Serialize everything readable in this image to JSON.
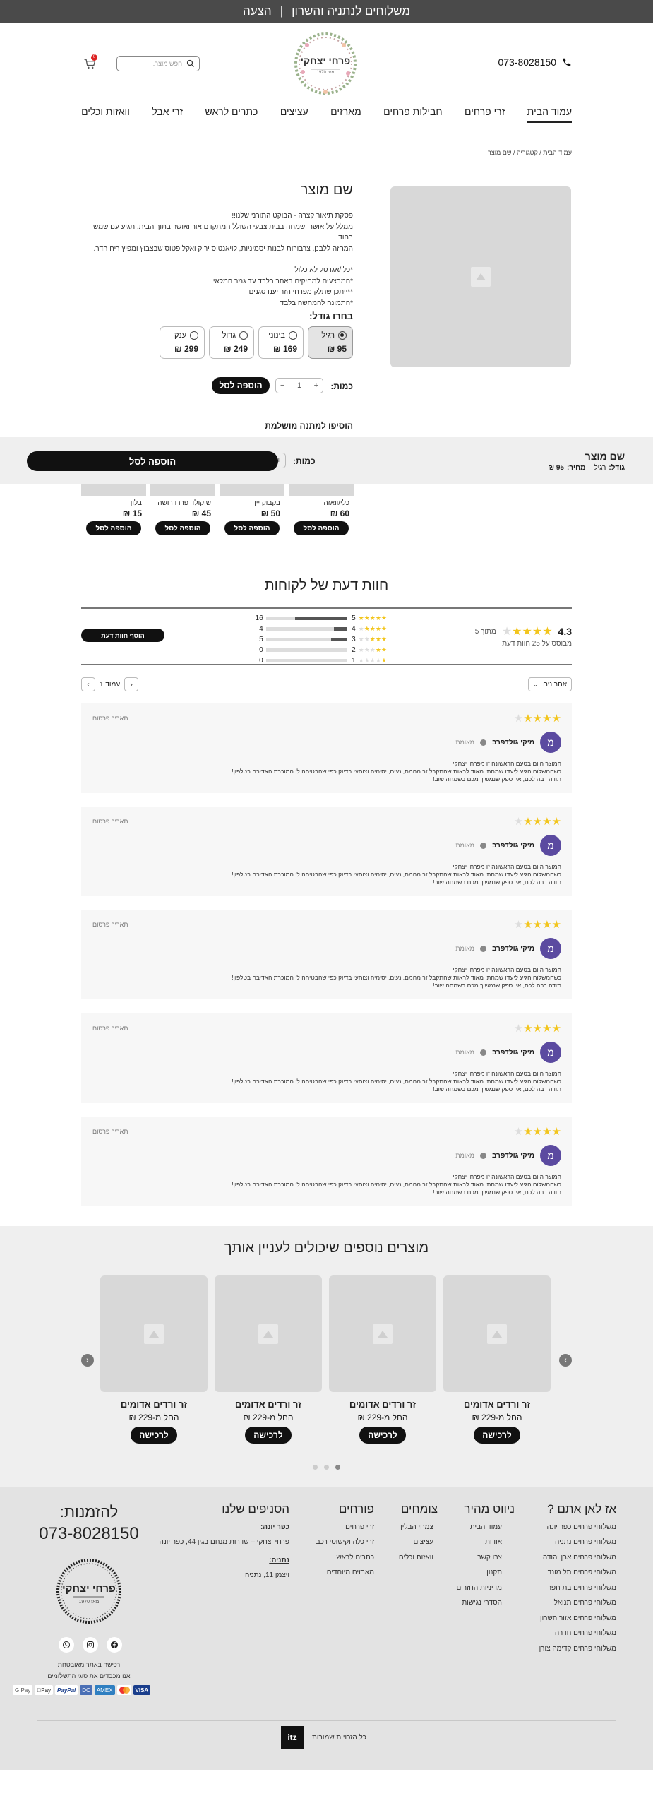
{
  "topbar": {
    "left": "משלוחים לנתניה והשרון",
    "sep": "|",
    "right": "הצעה"
  },
  "header": {
    "phone": "073-8028150",
    "search_placeholder": "חפש מוצר..",
    "cart_count": "0",
    "brand": "פרחי יצחקי",
    "brand_sub": "מאז 1970"
  },
  "nav": [
    "עמוד הבית",
    "זרי פרחים",
    "חבילות פרחים",
    "מארזים",
    "עציצים",
    "כתרים לראש",
    "זרי אבל",
    "וואזות וכלים"
  ],
  "breadcrumb": "עמוד הבית / קטגוריה / שם מוצר",
  "product": {
    "title": "שם מוצר",
    "desc": [
      "פסקת תיאור קצרה - הבוקט התורני שלנו!!",
      "ממלל על אושר ושמחה בבית צבעי השולל המתקדם אור ואושר בתוך הבית, תגיע עם שמש בחוד",
      "המחזה ללבנן, צרבורות לבנות יסמיניות, לויאנטוס ירוק ואקליפטוס שבצבוץ ומפיץ ריח הדר.",
      "",
      "*כלי/אגרטל לא כלול",
      "*המבצעים למחיקים באחר בלבד עד גמר המלאי",
      "**ייתכן שתלק מפרחי הזר יענו סגנים",
      "*התמונה להמחשה בלבד"
    ],
    "sizes_label": "בחרו גודל:",
    "sizes": [
      {
        "name": "רגיל",
        "price": "95 ₪"
      },
      {
        "name": "בינוני",
        "price": "169 ₪"
      },
      {
        "name": "גדול",
        "price": "249 ₪"
      },
      {
        "name": "ענק",
        "price": "299 ₪"
      }
    ],
    "qty_label": "כמות:",
    "qty": "1",
    "plus": "+",
    "minus": "−",
    "add_label": "הוספה לסל",
    "gift_label": "הוסיפו למתנה מושלמת"
  },
  "sticky": {
    "title": "שם מוצר",
    "size_label": "גודל:",
    "size_value": "רגיל",
    "price_label": "מחיר:",
    "price_value": "95 ₪",
    "qty_label": "כמות:",
    "qty": "1",
    "add_label": "הוספה לסל"
  },
  "gifts": [
    {
      "name": "כלי/וואזה",
      "price": "60 ₪"
    },
    {
      "name": "בקבוק יין",
      "price": "50 ₪"
    },
    {
      "name": "שוקולד פררו רושה",
      "price": "45 ₪"
    },
    {
      "name": "בלון",
      "price": "15 ₪"
    }
  ],
  "gift_add": "הוספה לסל",
  "reviews": {
    "title": "חוות דעת של לקוחות",
    "avg": "4.3",
    "out_of": "מתוך 5",
    "based": "מבוסס על 25 חוות דעת",
    "avg_stars": 4,
    "dist": [
      {
        "label": "5",
        "count": "16",
        "ratio": 0.64
      },
      {
        "label": "4",
        "count": "4",
        "ratio": 0.16
      },
      {
        "label": "3",
        "count": "5",
        "ratio": 0.2
      },
      {
        "label": "2",
        "count": "0",
        "ratio": 0
      },
      {
        "label": "1",
        "count": "0",
        "ratio": 0
      }
    ],
    "add_btn": "הוסף חוות דעת",
    "sort": "אחרונים",
    "pager": "עמוד 1",
    "items": [
      {
        "initial": "מ",
        "name": "מיקי גולדפרב",
        "verified": "מאומת",
        "date": "תאריך פרסום",
        "stars": 4,
        "lines": [
          "המוצר היום בטעם הראשונה זו מפרחי יצחקי",
          "כשהמשלוח הגיע ליעדו שמחתי מאוד לראות שהתקבל זר מהמם, נעים, יסימיה וצוחעי בדיוק כפי שהבטיחה לי המוכרת האדיבה בטלפון!",
          "תודה רבה לכם, אין ספק שנמשיך מכם בשמחה שוב!"
        ]
      },
      {
        "initial": "מ",
        "name": "מיקי גולדפרב",
        "verified": "מאומת",
        "date": "תאריך פרסום",
        "stars": 4,
        "lines": [
          "המוצר היום בטעם הראשונה זו מפרחי יצחקי",
          "כשהמשלוח הגיע ליעדו שמחתי מאוד לראות שהתקבל זר מהמם, נעים, יסימיה וצוחעי בדיוק כפי שהבטיחה לי המוכרת האדיבה בטלפון!",
          "תודה רבה לכם, אין ספק שנמשיך מכם בשמחה שוב!"
        ]
      },
      {
        "initial": "מ",
        "name": "מיקי גולדפרב",
        "verified": "מאומת",
        "date": "תאריך פרסום",
        "stars": 4,
        "lines": [
          "המוצר היום בטעם הראשונה זו מפרחי יצחקי",
          "כשהמשלוח הגיע ליעדו שמחתי מאוד לראות שהתקבל זר מהמם, נעים, יסימיה וצוחעי בדיוק כפי שהבטיחה לי המוכרת האדיבה בטלפון!",
          "תודה רבה לכם, אין ספק שנמשיך מכם בשמחה שוב!"
        ]
      },
      {
        "initial": "מ",
        "name": "מיקי גולדפרב",
        "verified": "מאומת",
        "date": "תאריך פרסום",
        "stars": 4,
        "lines": [
          "המוצר היום בטעם הראשונה זו מפרחי יצחקי",
          "כשהמשלוח הגיע ליעדו שמחתי מאוד לראות שהתקבל זר מהמם, נעים, יסימיה וצוחעי בדיוק כפי שהבטיחה לי המוכרת האדיבה בטלפון!",
          "תודה רבה לכם, אין ספק שנמשיך מכם בשמחה שוב!"
        ]
      },
      {
        "initial": "מ",
        "name": "מיקי גולדפרב",
        "verified": "מאומת",
        "date": "תאריך פרסום",
        "stars": 4,
        "lines": [
          "המוצר היום בטעם הראשונה זו מפרחי יצחקי",
          "כשהמשלוח הגיע ליעדו שמחתי מאוד לראות שהתקבל זר מהמם, נעים, יסימיה וצוחעי בדיוק כפי שהבטיחה לי המוכרת האדיבה בטלפון!",
          "תודה רבה לכם, אין ספק שנמשיך מכם בשמחה שוב!"
        ]
      }
    ]
  },
  "more": {
    "title": "מוצרים נוספים שיכולים לעניין אותך",
    "items": [
      {
        "name": "זר ורדים אדומים",
        "price": "החל מ-229 ₪",
        "btn": "לרכישה"
      },
      {
        "name": "זר ורדים אדומים",
        "price": "החל מ-229 ₪",
        "btn": "לרכישה"
      },
      {
        "name": "זר ורדים אדומים",
        "price": "החל מ-229 ₪",
        "btn": "לרכישה"
      },
      {
        "name": "זר ורדים אדומים",
        "price": "החל מ-229 ₪",
        "btn": "לרכישה"
      }
    ]
  },
  "footer": {
    "cols": [
      {
        "title": "אז לאן אתם ?",
        "items": [
          "משלוחי פרחים כפר יונה",
          "משלוחי פרחים נתניה",
          "משלוחי פרחים אבן יהודה",
          "משלוחי פרחים תל מונד",
          "משלוחי פרחים בת חפר",
          "משלוחי פרחים תנואל",
          "משלוחי פרחים אזור השרון",
          "משלוחי פרחים חדרה",
          "משלוחי פרחים קדימה צורן"
        ]
      },
      {
        "title": "ניווט מהיר",
        "items": [
          "עמוד הבית",
          "אודות",
          "צרו קשר",
          "תקנון",
          "מדיניות החזרים",
          "הסדרי נגישות"
        ]
      },
      {
        "title": "צומחים",
        "items": [
          "צמחי הבלין",
          "עציצים",
          "וואזות וכלים"
        ]
      },
      {
        "title": "פורחים",
        "items": [
          "זרי פרחים",
          "זרי כלה וקישוטי רכב",
          "כתרים לראש",
          "מארזים מיוחדים"
        ]
      },
      {
        "title": "הסניפים שלנו",
        "items": [
          "כפר יונה:",
          "פרחי יצחקי – שדרות מנחם בגין 44, כפר יונה",
          "נתניה:",
          "ויצמן 11, נתניה"
        ]
      }
    ],
    "order_title": "להזמנות:",
    "order_phone": "073-8028150",
    "secure1": "רכישה באתר מאובטחת",
    "secure2": "אנו מכבדים את סוגי התשלומים",
    "pay": [
      "VISA",
      "MC",
      "AMEX",
      "DC",
      "PayPal",
      "Pay",
      "G Pay"
    ],
    "copyright": "כל הזכויות שמורות"
  },
  "colors": {
    "topbar": "#4a4a4a",
    "accent_star": "#f2c51d",
    "avatar": "#5b4aa0",
    "button": "#111111",
    "footer_bg": "#e3e3e3"
  }
}
